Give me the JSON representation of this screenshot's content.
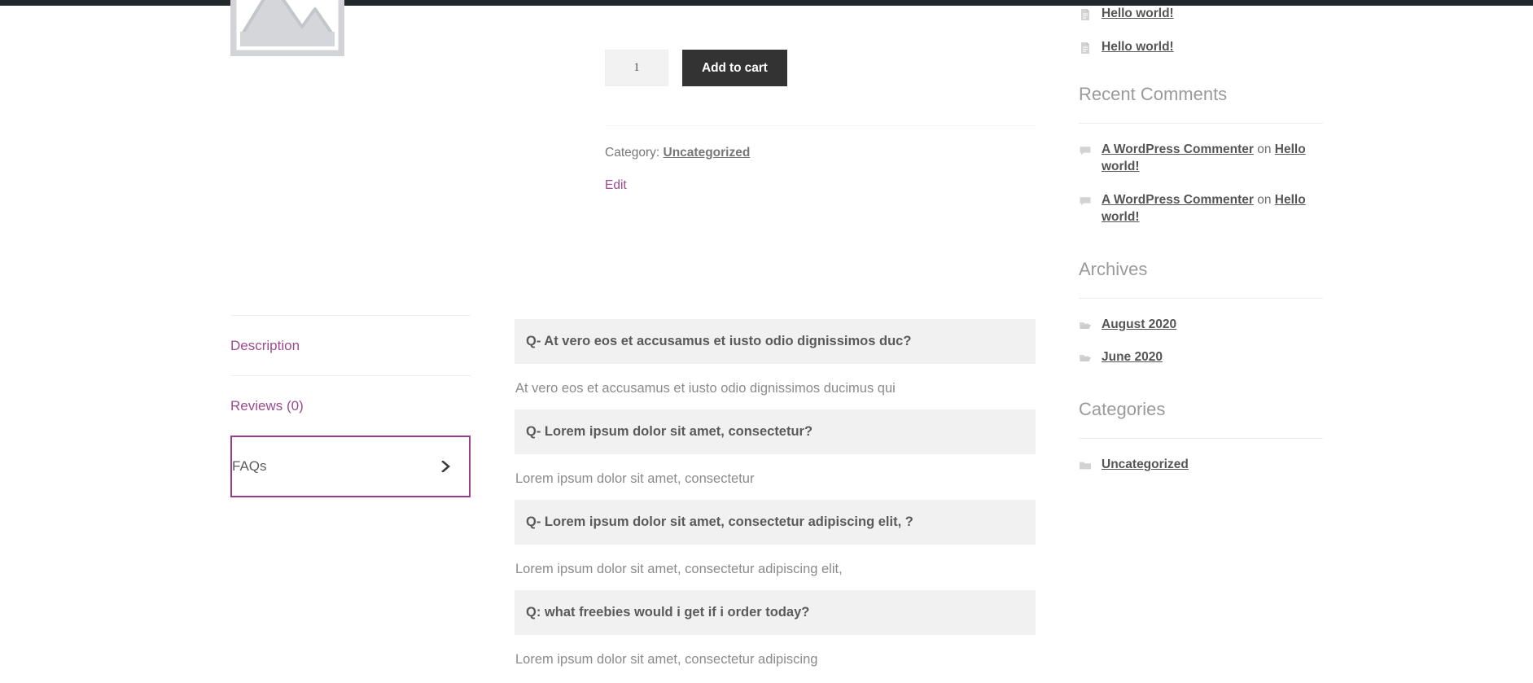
{
  "theme": {
    "accent_purple": "#963e8c",
    "link_purple": "#9b4a91",
    "button_dark": "#333333",
    "faq_question_bg": "#f1f1f1",
    "admin_bar": "#23282d"
  },
  "product": {
    "placeholder_image_alt": "Awaiting product image",
    "quantity_value": "1",
    "add_to_cart_label": "Add to cart",
    "category_label": "Category:",
    "category_value": "Uncategorized",
    "edit_label": "Edit"
  },
  "tabs": [
    {
      "label": "Description",
      "active": false
    },
    {
      "label": "Reviews (0)",
      "active": false
    },
    {
      "label": "FAQs",
      "active": true
    }
  ],
  "faqs": [
    {
      "question": "Q- At vero eos et accusamus et iusto odio dignissimos duc?",
      "answer": "At vero eos et accusamus et iusto odio dignissimos ducimus qui"
    },
    {
      "question": "Q- Lorem ipsum dolor sit amet, consectetur?",
      "answer": "Lorem ipsum dolor sit amet, consectetur"
    },
    {
      "question": "Q- Lorem ipsum dolor sit amet, consectetur adipiscing elit, ?",
      "answer": "Lorem ipsum dolor sit amet, consectetur adipiscing elit,"
    },
    {
      "question": "Q: what freebies would i get if i order today?",
      "answer": "Lorem ipsum dolor sit amet, consectetur adipiscing"
    }
  ],
  "sidebar": {
    "recent_posts": [
      {
        "icon": "document-icon",
        "label": "Hello world!"
      },
      {
        "icon": "document-icon",
        "label": "Hello world!"
      }
    ],
    "recent_comments_heading": "Recent Comments",
    "recent_comments": [
      {
        "icon": "comment-icon",
        "author": "A WordPress Commenter",
        "connector": " on ",
        "post": "Hello world!"
      },
      {
        "icon": "comment-icon",
        "author": "A WordPress Commenter",
        "connector": " on ",
        "post": "Hello world!"
      }
    ],
    "archives_heading": "Archives",
    "archives": [
      {
        "icon": "folder-open-icon",
        "label": "August 2020"
      },
      {
        "icon": "folder-open-icon",
        "label": "June 2020"
      }
    ],
    "categories_heading": "Categories",
    "categories": [
      {
        "icon": "folder-icon",
        "label": "Uncategorized"
      }
    ]
  }
}
